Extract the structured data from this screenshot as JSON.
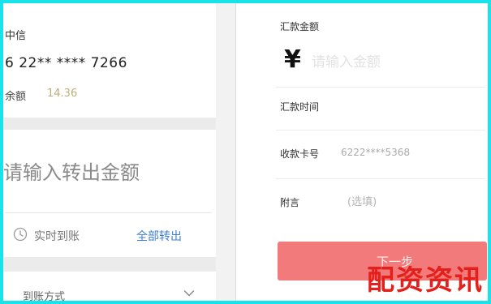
{
  "left": {
    "account_card": {
      "bank_name": "中信",
      "card_number": "6 22** **** 7266",
      "balance_label": "余额",
      "balance_value": "14.36"
    },
    "amount_placeholder": "请输入转出金额",
    "arrival_hint": "实时到账",
    "transfer_all_label": "全部转出",
    "method_label": "到账方式"
  },
  "right": {
    "amount_label": "汇款金额",
    "currency_symbol": "¥",
    "amount_placeholder": "请输入金额",
    "time_label": "汇款时间",
    "card_label": "收款卡号",
    "card_value": "6222****5368",
    "memo_label": "附言",
    "memo_placeholder": "(选填)",
    "next_button_label": "下一步"
  },
  "watermark": "配资资讯",
  "colors": {
    "frame": "#19e3ea",
    "next_button": "#f27a7a",
    "link": "#3d7fd6",
    "balance_value": "#c0ae78",
    "watermark": "#e3201b"
  },
  "icons": {
    "arrival": "clock-icon",
    "method": "chevron-down-icon"
  }
}
